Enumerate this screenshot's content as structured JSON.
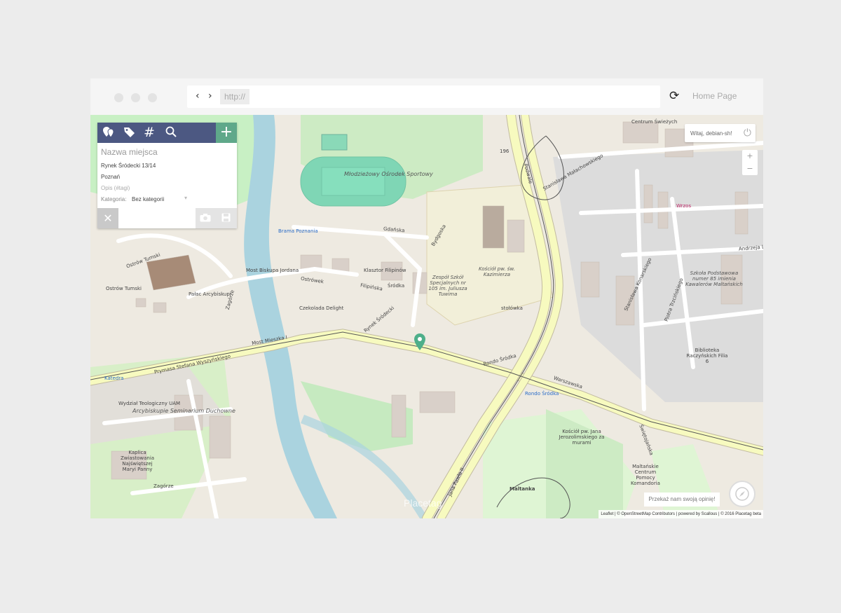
{
  "browser": {
    "url_placeholder": "http://",
    "home_label": "Home Page",
    "nav_arrows": "‹ ›",
    "reload_glyph": "⟳"
  },
  "panel": {
    "name_placeholder": "Nazwa miejsca",
    "address": "Rynek Śródecki 13/14",
    "city": "Poznań",
    "description_placeholder": "Opis (#tagi)",
    "category_label": "Kategoria:",
    "category_value": "Bez kategorii",
    "close_glyph": "✕",
    "add_glyph": "+",
    "tag_glyph": "#"
  },
  "controls": {
    "welcome": "Witaj, debian-sh!",
    "zoom_in": "+",
    "zoom_out": "−",
    "feedback": "Przekaż nam swoją opinię!",
    "attribution": "Leaflet | © OpenStreetMap Contributors | powered by Scallous | © 2016 Placetag beta",
    "watermark": "Placetag"
  },
  "map": {
    "labels_large": [
      "Młodzieżowy Ośrodek Sportowy",
      "Arcybiskupie Seminarium Duchowne",
      "Szkoła Podstawowa numer 85 imienia Kawalerów Maltańskich",
      "Zespół Szkół Specjalnych nr 105 im. Juliusza Tuwima",
      "Kościół pw. św. Kazimierza"
    ],
    "labels_street": [
      "Ostrów Tumski",
      "Most Mieszka I",
      "Prymasa Stefana Wyszyńskiego",
      "Gdańska",
      "Bydgoska",
      "Podwale",
      "Stanisława Małachowskiego",
      "Stanisława Konarskiego",
      "Piotra Trzcińskiego",
      "Andrzeja Li",
      "Rondo Śródka",
      "Warszawska",
      "Filipińska",
      "Ostrówek",
      "Rynek Śródecki",
      "Jana Pawła II",
      "Zagórze",
      "Zagórze",
      "Most Biskupa Jordana",
      "Świętojańska"
    ],
    "labels_poi": [
      "Brama Poznania",
      "Klasztor Filipinów",
      "Śródka",
      "Pałac Arcybiskupi",
      "Czekolada Delight",
      "Wydział Teologiczny UAM",
      "Kościół pw. Jana Jerozolimskiego za murami",
      "Maltańskie Centrum Pomocy Komandoria",
      "Maltanka",
      "Biblioteka Raczyńskich Filia 6",
      "Katedra",
      "Kaplica Zwiastowania Najświętszej Maryi Panny",
      "Ostrów Tumski",
      "Centrum Świeżych",
      "Rondo Śródka",
      "196",
      "stołówka",
      "Wrzos"
    ]
  },
  "colors": {
    "toolbar": "#4c5882",
    "add": "#5fa88a",
    "river": "#aad3df",
    "park": "#c8f0c4",
    "road": "#f7fabf",
    "pin": "#4eaf8a"
  }
}
